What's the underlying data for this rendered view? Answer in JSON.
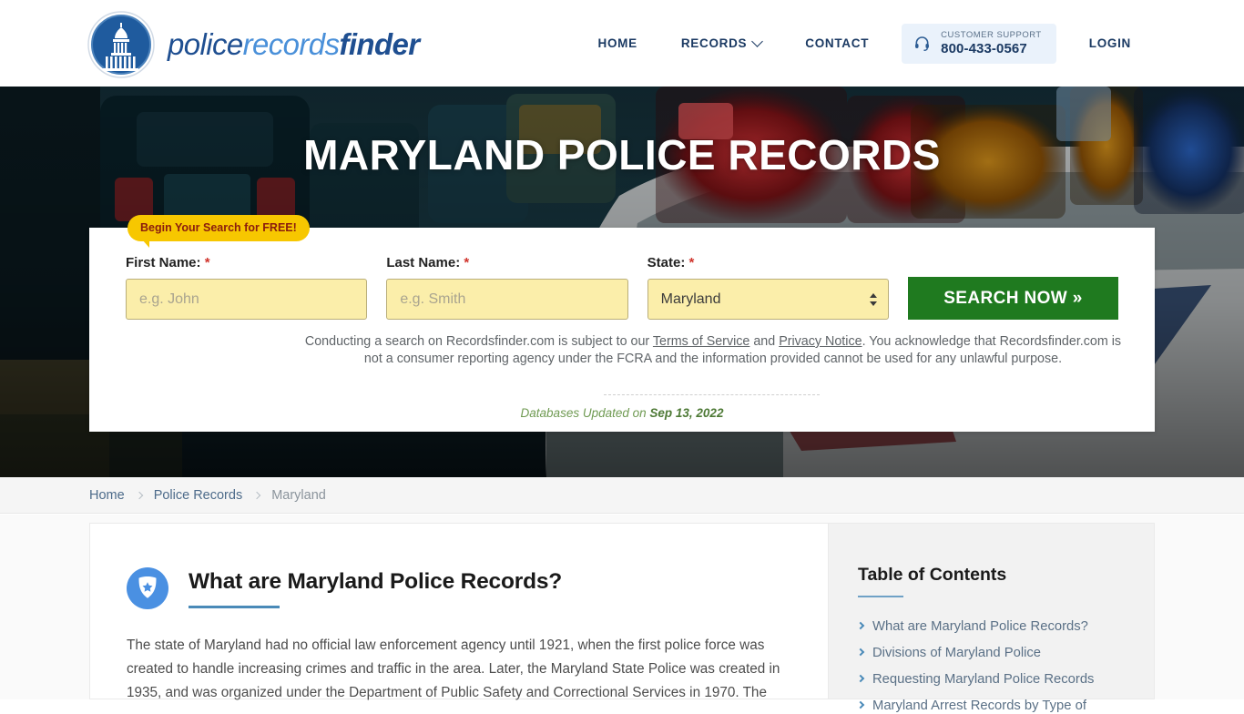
{
  "header": {
    "logo": {
      "icon": "capitol-dome-icon",
      "part1": "police",
      "part2": "records",
      "part3": "finder"
    },
    "nav": [
      {
        "label": "HOME"
      },
      {
        "label": "RECORDS",
        "icon": "chevron-down-icon"
      },
      {
        "label": "CONTACT"
      }
    ],
    "support": {
      "icon": "headset-icon",
      "label": "CUSTOMER SUPPORT",
      "phone": "800-433-0567"
    },
    "login_label": "LOGIN"
  },
  "hero": {
    "title": "MARYLAND POLICE RECORDS"
  },
  "search": {
    "badge": "Begin Your Search for FREE!",
    "first_name": {
      "label": "First Name:",
      "required": "*",
      "value": "",
      "placeholder": "e.g. John"
    },
    "last_name": {
      "label": "Last Name:",
      "required": "*",
      "value": "",
      "placeholder": "e.g. Smith"
    },
    "state": {
      "label": "State:",
      "required": "*",
      "selected": "Maryland",
      "options": [
        "Maryland"
      ]
    },
    "submit_label": "SEARCH NOW »",
    "disclaimer": {
      "before_tos": "Conducting a search on Recordsfinder.com is subject to our ",
      "tos_link": "Terms of Service",
      "between_links": " and ",
      "privacy_link": "Privacy Notice",
      "after_links": ". You acknowledge that Recordsfinder.com is not a consumer reporting agency under the FCRA and the information provided cannot be used for any unlawful purpose."
    },
    "updated_prefix": "Databases Updated on ",
    "updated_date": "Sep 13, 2022"
  },
  "breadcrumb": [
    {
      "label": "Home"
    },
    {
      "label": "Police Records"
    },
    {
      "label": "Maryland"
    }
  ],
  "content": {
    "section_icon": "police-badge-icon",
    "heading": "What are Maryland Police Records?",
    "paragraph": "The state of Maryland had no official law enforcement agency until 1921, when the first police force was created to handle increasing crimes and traffic in the area. Later, the Maryland State Police was created in 1935, and was organized under the Department of Public Safety and Correctional Services in 1970. The"
  },
  "toc": {
    "title": "Table of Contents",
    "items": [
      {
        "label": "What are Maryland Police Records?"
      },
      {
        "label": "Divisions of Maryland Police"
      },
      {
        "label": "Requesting Maryland Police Records"
      },
      {
        "label": "Maryland Arrest Records by Type of"
      }
    ]
  },
  "colors": {
    "brand_dark_blue": "#1f4f91",
    "brand_light_blue": "#4a90d9",
    "accent_blue": "#4a8ab8",
    "search_button_green": "#1f7a1f",
    "badge_yellow": "#f7c700",
    "input_yellow": "#fbeeaa",
    "required_red": "#d0342c",
    "updated_green": "#6f9a52"
  }
}
